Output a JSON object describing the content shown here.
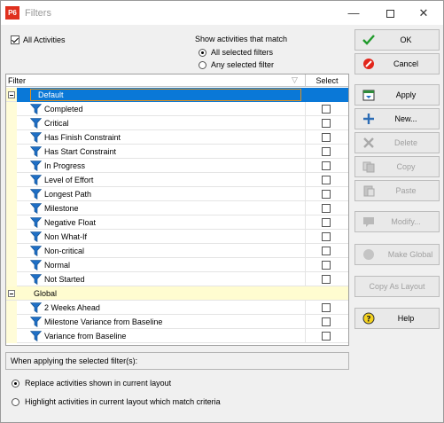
{
  "window": {
    "title": "Filters",
    "app_icon_text": "P6"
  },
  "top": {
    "all_activities_label": "All Activities",
    "all_activities_checked": true,
    "match_heading": "Show activities that match",
    "match_options": [
      {
        "label": "All selected filters",
        "selected": true
      },
      {
        "label": "Any selected filter",
        "selected": false
      }
    ]
  },
  "grid": {
    "col_filter": "Filter",
    "col_select": "Select",
    "groups": [
      {
        "name": "Default",
        "selected": true,
        "items": [
          "Completed",
          "Critical",
          "Has Finish Constraint",
          "Has Start Constraint",
          "In Progress",
          "Level of Effort",
          "Longest Path",
          "Milestone",
          "Negative Float",
          "Non What-If",
          "Non-critical",
          "Normal",
          "Not Started"
        ]
      },
      {
        "name": "Global",
        "selected": false,
        "items": [
          "2 Weeks Ahead",
          "Milestone Variance from Baseline",
          "Variance from Baseline"
        ]
      }
    ]
  },
  "apply": {
    "heading": "When applying the selected filter(s):",
    "options": [
      {
        "label": "Replace activities shown in current layout",
        "selected": true
      },
      {
        "label": "Highlight activities in current layout which match criteria",
        "selected": false
      }
    ]
  },
  "buttons": {
    "ok": "OK",
    "cancel": "Cancel",
    "apply": "Apply",
    "new": "New...",
    "delete": "Delete",
    "copy": "Copy",
    "paste": "Paste",
    "modify": "Modify...",
    "make_global": "Make Global",
    "copy_as_layout": "Copy As Layout",
    "help": "Help"
  },
  "colors": {
    "selection": "#0a78d7",
    "group_bg": "#fffcd0",
    "accent_outline": "#e2901a",
    "funnel": "#1f6fc5"
  }
}
